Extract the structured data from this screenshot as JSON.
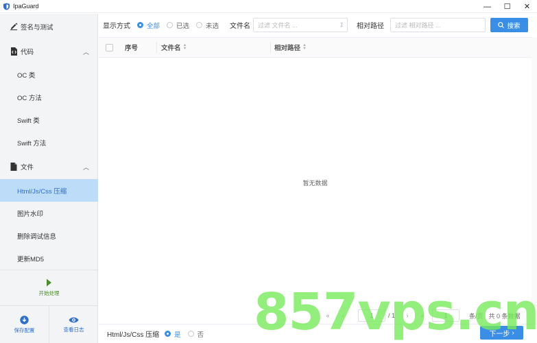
{
  "window": {
    "title": "IpaGuard",
    "controls": [
      "—",
      "☐",
      "✕"
    ]
  },
  "sidebar": {
    "sign": "签名与测试",
    "code_group": "代码",
    "code_items": [
      "OC 类",
      "OC 方法",
      "Swift 类",
      "Swift 方法"
    ],
    "file_group": "文件",
    "file_items": [
      "Html/Js/Css 压缩",
      "图片水印",
      "删除调试信息",
      "更新MD5"
    ],
    "active_item": "Html/Js/Css 压缩",
    "start": "开始处理",
    "save_config": "保存配置",
    "view_log": "查看日志"
  },
  "filter": {
    "display_label": "显示方式",
    "options": [
      "全部",
      "已选",
      "未选"
    ],
    "selected": "全部",
    "filename_label": "文件名",
    "filename_placeholder": "过滤 文件名 ...",
    "path_label": "相对路径",
    "path_placeholder": "过滤 相对路径 ...",
    "search_button": "搜索"
  },
  "table": {
    "columns": [
      "序号",
      "文件名",
      "相对路径"
    ],
    "empty_text": "暂无数据"
  },
  "pagination": {
    "page_input": "1",
    "page_total": "/ 1",
    "goto_page": "1",
    "per_page": "条/页",
    "total": "共 0 条数据"
  },
  "bottom": {
    "option_label": "Html/Js/Css 压缩",
    "yes": "是",
    "no": "否",
    "selected": "是",
    "next_button": "下一步"
  },
  "watermark": "857vps.cn",
  "colors": {
    "accent": "#3a8ee6",
    "active_bg": "#bcdcf7",
    "start_green": "#4a8d2a",
    "sidebar_bg": "#f3f4f6"
  }
}
